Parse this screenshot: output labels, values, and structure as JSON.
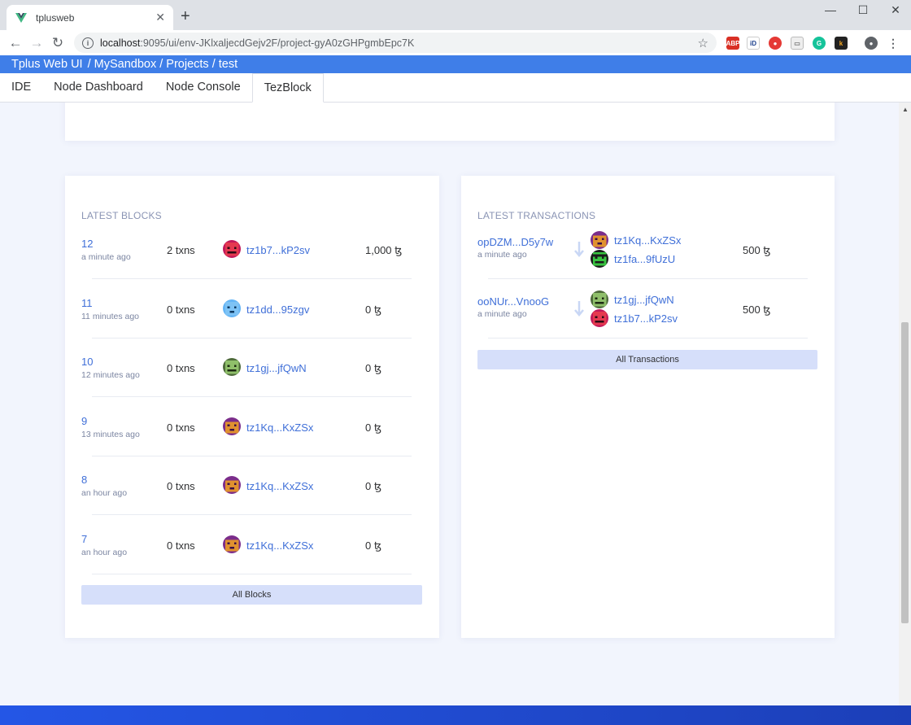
{
  "browser": {
    "tab_title": "tplusweb",
    "tab_close": "✕",
    "new_tab": "+",
    "url_host": "localhost",
    "url_path": ":9095/ui/env-JKlxaljecdGejv2F/project-gyA0zGHPgmbEpc7K",
    "controls": {
      "minimize": "—",
      "maximize": "☐",
      "close": "✕"
    }
  },
  "app": {
    "title": "Tplus Web UI",
    "breadcrumb": "/ MySandbox / Projects / test",
    "nav_tabs": [
      "IDE",
      "Node Dashboard",
      "Node Console",
      "TezBlock"
    ],
    "active_tab": "TezBlock"
  },
  "latest_blocks": {
    "title": "LATEST BLOCKS",
    "rows": [
      {
        "number": "12",
        "time": "a minute ago",
        "txns": "2 txns",
        "baker": "tz1b7...kP2sv",
        "amount": "1,000 ꜩ",
        "avatar": "red-face"
      },
      {
        "number": "11",
        "time": "11 minutes ago",
        "txns": "0 txns",
        "baker": "tz1dd...95zgv",
        "amount": "0 ꜩ",
        "avatar": "blue-face"
      },
      {
        "number": "10",
        "time": "12 minutes ago",
        "txns": "0 txns",
        "baker": "tz1gj...jfQwN",
        "amount": "0 ꜩ",
        "avatar": "green-face"
      },
      {
        "number": "9",
        "time": "13 minutes ago",
        "txns": "0 txns",
        "baker": "tz1Kq...KxZSx",
        "amount": "0 ꜩ",
        "avatar": "purple-face"
      },
      {
        "number": "8",
        "time": "an hour ago",
        "txns": "0 txns",
        "baker": "tz1Kq...KxZSx",
        "amount": "0 ꜩ",
        "avatar": "purple-face"
      },
      {
        "number": "7",
        "time": "an hour ago",
        "txns": "0 txns",
        "baker": "tz1Kq...KxZSx",
        "amount": "0 ꜩ",
        "avatar": "purple-face"
      }
    ],
    "button": "All Blocks"
  },
  "latest_transactions": {
    "title": "LATEST TRANSACTIONS",
    "rows": [
      {
        "hash": "opDZM...D5y7w",
        "time": "a minute ago",
        "from": "tz1Kq...KxZSx",
        "to": "tz1fa...9fUzU",
        "amount": "500 ꜩ",
        "from_avatar": "purple-face",
        "to_avatar": "dark-green-face"
      },
      {
        "hash": "ooNUr...VnooG",
        "time": "a minute ago",
        "from": "tz1gj...jfQwN",
        "to": "tz1b7...kP2sv",
        "amount": "500 ꜩ",
        "from_avatar": "green-face",
        "to_avatar": "red-face"
      }
    ],
    "button": "All Transactions"
  },
  "colors": {
    "header_blue": "#3f7ee8",
    "link_blue": "#3f6fd8",
    "page_bg": "#f2f5fd",
    "button_bg": "#d6dffa"
  }
}
